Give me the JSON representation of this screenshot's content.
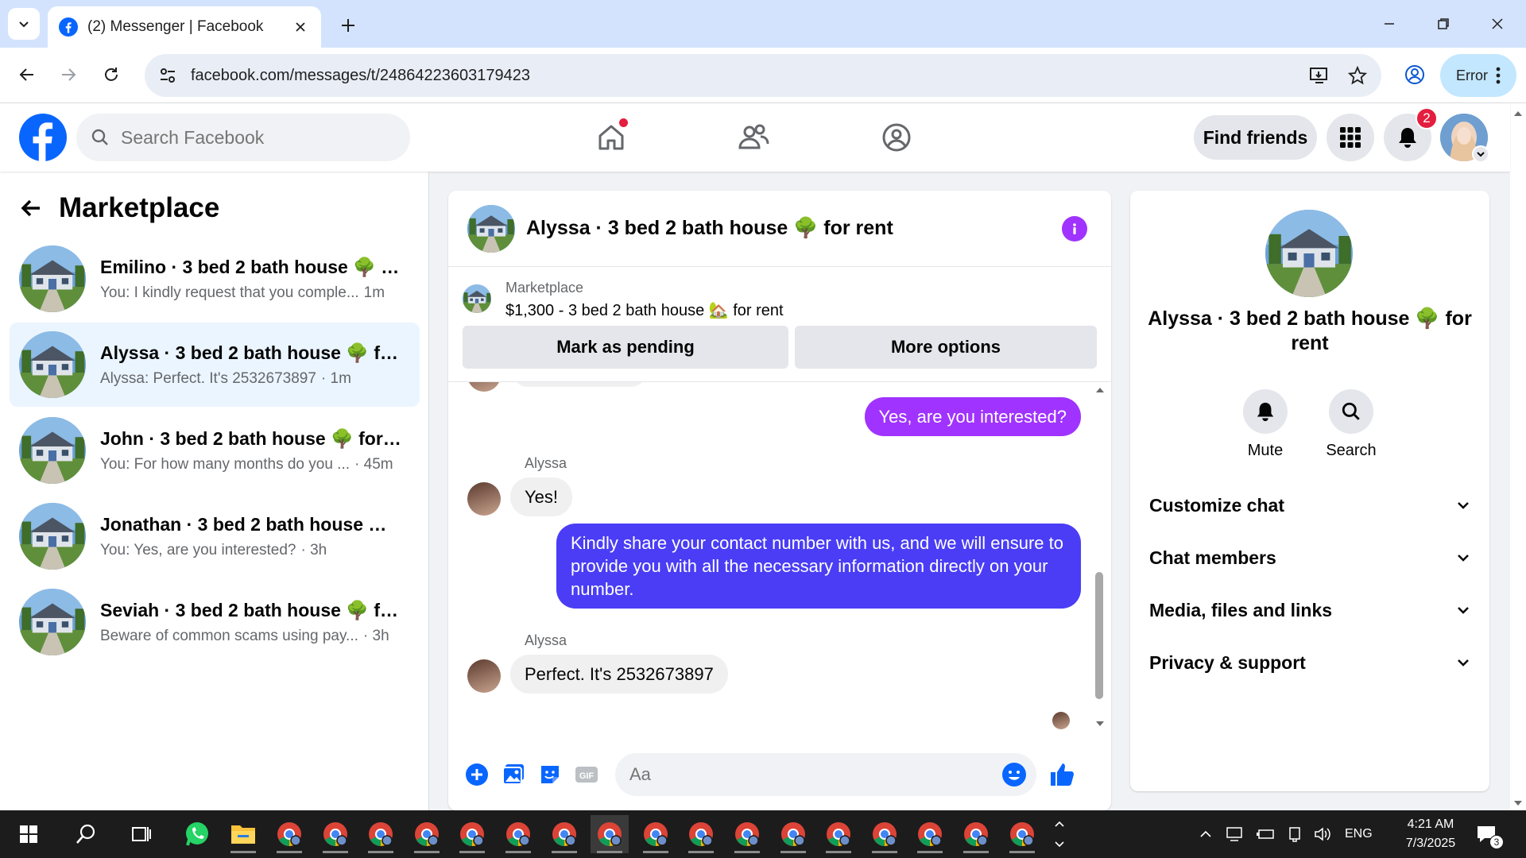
{
  "browser": {
    "tab_title": "(2) Messenger | Facebook",
    "url": "facebook.com/messages/t/24864223603179423",
    "profile_status": "Error"
  },
  "fb": {
    "search_placeholder": "Search Facebook",
    "find_friends": "Find friends",
    "notification_count": "2",
    "brand_color": "#0866ff"
  },
  "left": {
    "title": "Marketplace",
    "conversations": [
      {
        "name": "Emilino · 3 bed 2 bath house 🌳 fo...",
        "preview": "You: I kindly request that you comple...",
        "time": "1m"
      },
      {
        "name": "Alyssa · 3 bed 2 bath house 🌳 for ...",
        "preview": "Alyssa: Perfect. It's 2532673897",
        "time": "· 1m"
      },
      {
        "name": "John · 3 bed 2 bath house 🌳 for r...",
        "preview": "You: For how many months do you ...",
        "time": "· 45m"
      },
      {
        "name": "Jonathan · 3 bed 2 bath house 🌳 ...",
        "preview": "You: Yes, are you interested?",
        "time": "· 3h"
      },
      {
        "name": "Seviah · 3 bed 2 bath house 🌳 for...",
        "preview": "Beware of common scams using pay...",
        "time": "· 3h"
      }
    ]
  },
  "chat": {
    "title": "Alyssa · 3 bed 2 bath house 🌳 for rent",
    "listing_source": "Marketplace",
    "listing_desc": "$1,300 - 3 bed 2 bath house 🏡 for rent",
    "mark_pending": "Mark as pending",
    "more_options": "More options",
    "messages": [
      {
        "text": "Yes, are you interested?"
      },
      {
        "sender": "Alyssa",
        "text": "Yes!"
      },
      {
        "text": "Kindly share your contact number with us, and we will ensure to provide you with all the necessary information directly on your number."
      },
      {
        "sender": "Alyssa",
        "text": "Perfect. It's 2532673897"
      }
    ],
    "composer_placeholder": "Aa",
    "accent_purple": "#a033ff",
    "accent_blue": "#4a3df5"
  },
  "right": {
    "name": "Alyssa · 3 bed 2 bath house 🌳 for rent",
    "mute": "Mute",
    "search": "Search",
    "sections": [
      "Customize chat",
      "Chat members",
      "Media, files and links",
      "Privacy & support"
    ]
  },
  "taskbar": {
    "lang": "ENG",
    "time": "4:21 AM",
    "date": "7/3/2025",
    "notif_count": "3"
  }
}
